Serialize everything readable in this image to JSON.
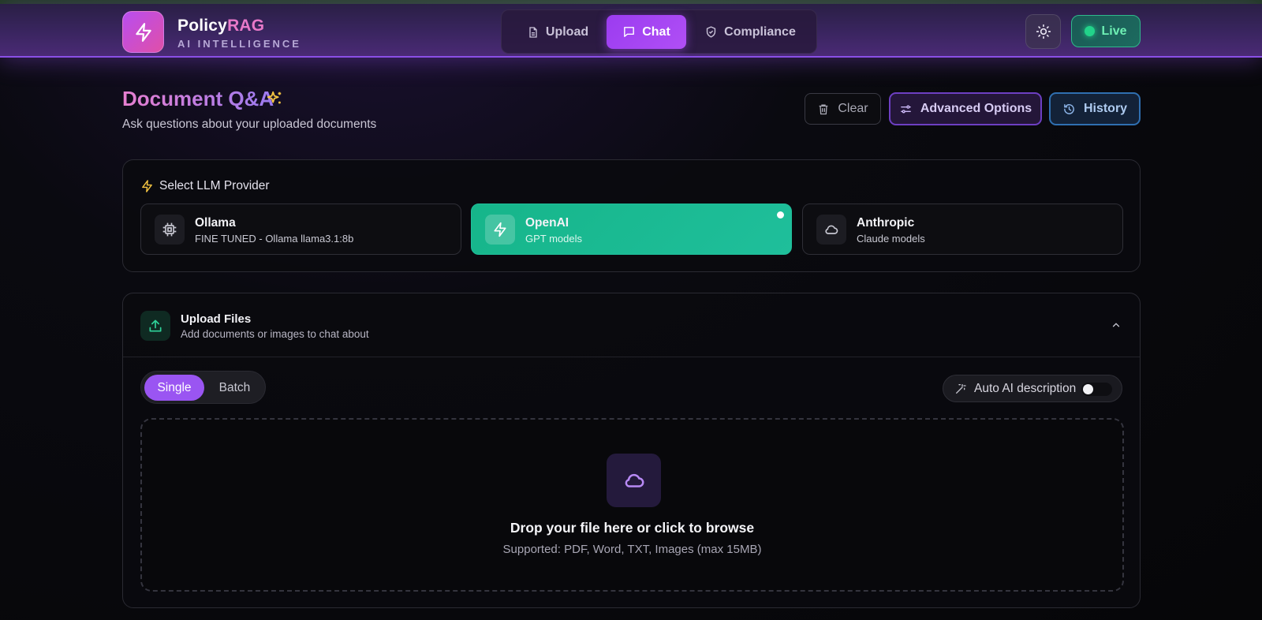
{
  "header": {
    "brand_name": "Policy",
    "brand_accent": "RAG",
    "brand_subtitle": "AI INTELLIGENCE",
    "nav": [
      {
        "label": "Upload",
        "icon": "file-icon",
        "active": false
      },
      {
        "label": "Chat",
        "icon": "chat-icon",
        "active": true
      },
      {
        "label": "Compliance",
        "icon": "shield-icon",
        "active": false
      }
    ],
    "status_label": "Live"
  },
  "page": {
    "title": "Document Q&A",
    "subtitle": "Ask questions about your uploaded documents",
    "actions": {
      "clear": "Clear",
      "advanced": "Advanced Options",
      "history": "History"
    }
  },
  "provider_panel": {
    "title": "Select LLM Provider",
    "providers": [
      {
        "name": "Ollama",
        "desc": "FINE TUNED - Ollama llama3.1:8b",
        "icon": "cpu-icon",
        "selected": false
      },
      {
        "name": "OpenAI",
        "desc": "GPT models",
        "icon": "lightning-icon",
        "selected": true
      },
      {
        "name": "Anthropic",
        "desc": "Claude models",
        "icon": "cloud-icon",
        "selected": false
      }
    ]
  },
  "upload_panel": {
    "title": "Upload Files",
    "subtitle": "Add documents or images to chat about",
    "modes": [
      "Single",
      "Batch"
    ],
    "active_mode": "Single",
    "auto_ai_label": "Auto AI description",
    "auto_ai_enabled": false,
    "drop_title": "Drop your file here or click to browse",
    "drop_subtitle": "Supported: PDF, Word, TXT, Images (max 15MB)"
  },
  "colors": {
    "accent_purple": "#9b3cf0",
    "accent_green": "#1fbf9b",
    "live_green": "#22d38a"
  }
}
